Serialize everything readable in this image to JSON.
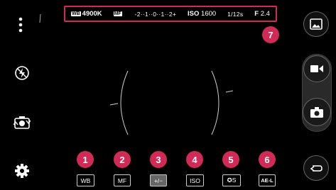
{
  "info_bar": {
    "wb_tag": "WB",
    "wb_value": "4900K",
    "mf_tag": "MF",
    "ev_scale": "-2··1··0··1··2+",
    "iso_label": "ISO",
    "iso_value": "1600",
    "shutter": "1/12s",
    "aperture_label": "F",
    "aperture_value": "2.4"
  },
  "badges": [
    "1",
    "2",
    "3",
    "4",
    "5",
    "6",
    "7"
  ],
  "modes": [
    {
      "label": "WB",
      "active": false
    },
    {
      "label": "MF",
      "active": false
    },
    {
      "label": "+/−",
      "active": true
    },
    {
      "label": "ISO",
      "active": false
    },
    {
      "label": "✪S",
      "active": false
    },
    {
      "label": "AE-L",
      "active": false
    }
  ],
  "left_icons": [
    "more-icon",
    "flash-off-icon",
    "switch-camera-icon",
    "settings-icon"
  ],
  "right_icons": [
    "gallery-icon",
    "video-record-icon",
    "camera-shutter-icon",
    "back-icon"
  ],
  "colors": {
    "accent": "#d22a57",
    "background": "#000000"
  }
}
